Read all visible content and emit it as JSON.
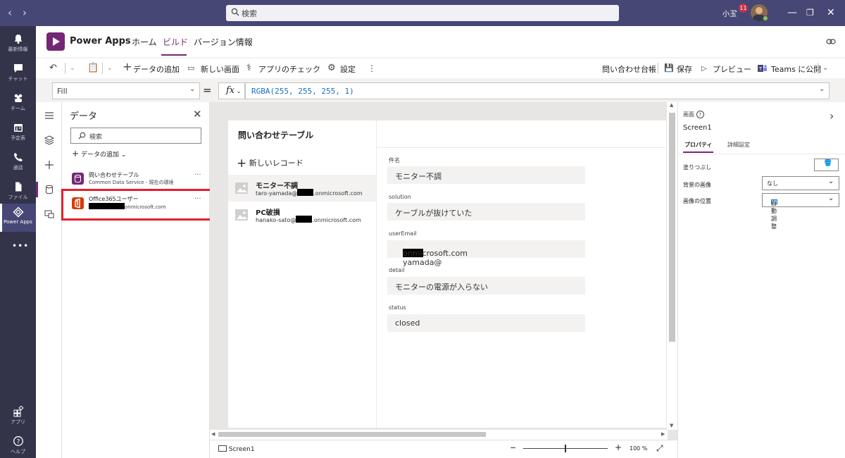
{
  "teams": {
    "search_placeholder": "検索",
    "user_name": "小玉",
    "notification_count": "11",
    "rail": [
      {
        "label": "最新情報",
        "icon": "bell-icon"
      },
      {
        "label": "チャット",
        "icon": "chat-icon"
      },
      {
        "label": "チーム",
        "icon": "teams-icon"
      },
      {
        "label": "予定表",
        "icon": "calendar-icon"
      },
      {
        "label": "通話",
        "icon": "phone-icon"
      },
      {
        "label": "ファイル",
        "icon": "file-icon"
      },
      {
        "label": "Power Apps",
        "icon": "power-apps-icon"
      },
      {
        "label": "アプリ",
        "icon": "apps-icon"
      },
      {
        "label": "ヘルプ",
        "icon": "help-icon"
      }
    ]
  },
  "powerapps": {
    "title": "Power Apps",
    "tabs": [
      "ホーム",
      "ビルド",
      "バージョン情報"
    ],
    "active_tab": "ビルド"
  },
  "commandbar": {
    "add_data": "データの追加",
    "new_screen": "新しい画面",
    "app_checker": "アプリのチェック",
    "settings": "設定",
    "app_name": "問い合わせ台帳",
    "save": "保存",
    "preview": "プレビュー",
    "publish_teams": "Teams に公開"
  },
  "formula": {
    "property": "Fill",
    "fx": "fx",
    "expression": "RGBA(255, 255, 255, 1)"
  },
  "data_panel": {
    "title": "データ",
    "search_placeholder": "検索",
    "add_data": "データの追加",
    "sources": [
      {
        "name": "問い合わせテーブル",
        "subtitle": "Common Data Service - 現在の環境"
      },
      {
        "name": "Office365ユーザー",
        "subtitle_suffix": "onmicrosoft.com"
      }
    ]
  },
  "app": {
    "title": "問い合わせテーブル",
    "new_record": "新しいレコード",
    "records": [
      {
        "title": "モニター不調",
        "email_prefix": "taro-yamada@",
        "email_suffix": ".onmicrosoft.com"
      },
      {
        "title": "PC破損",
        "email_prefix": "hanako-sato@",
        "email_suffix": ".onmicrosoft.com"
      }
    ],
    "fields": [
      {
        "label": "件名",
        "value": "モニター不調"
      },
      {
        "label": "solution",
        "value": "ケーブルが抜けていた"
      },
      {
        "label": "userEmail",
        "value_prefix": "taro-yamada@",
        "value_suffix": "onmicrosoft.com"
      },
      {
        "label": "detail",
        "value": "モニターの電源が入らない"
      },
      {
        "label": "status",
        "value": "closed"
      }
    ]
  },
  "statusbar": {
    "screen": "Screen1",
    "zoom_minus": "−",
    "zoom_plus": "+",
    "zoom": "100 %",
    "zoom_fraction": 0.5
  },
  "properties": {
    "kind": "画面",
    "name": "Screen1",
    "tab_props": "プロパティ",
    "tab_advanced": "詳細設定",
    "fill_label": "塗りつぶし",
    "bg_image_label": "背景の画像",
    "bg_image_value": "なし",
    "image_pos_label": "画像の位置",
    "image_pos_value": "自動調整"
  },
  "colors": {
    "teams_bar": "#464775",
    "rail": "#33344a",
    "accent": "#742774",
    "highlight": "#e3202a",
    "office_orange": "#d83b01"
  }
}
